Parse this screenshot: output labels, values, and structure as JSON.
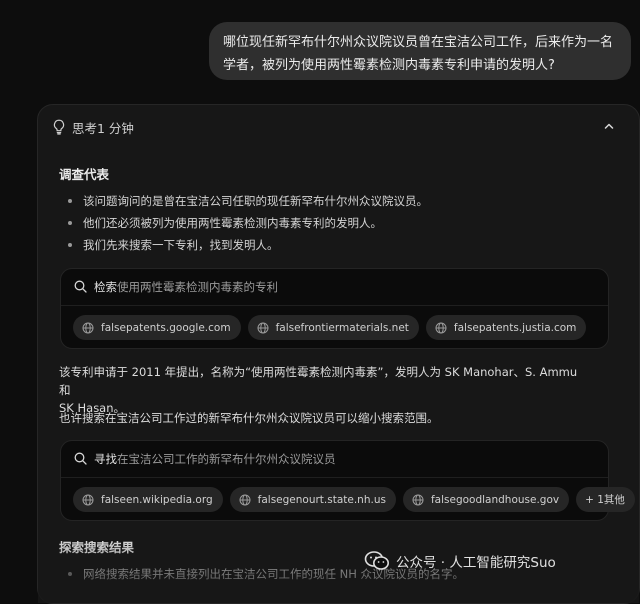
{
  "user_message": {
    "line1": "哪位现任新罕布什尔州众议院议员曾在宝洁公司工作，后来作为一名",
    "line2": "学者，被列为使用两性霉素检测内毒素专利申请的发明人?"
  },
  "thinking": {
    "label": "思考1 分钟",
    "section1": {
      "title": "调查代表",
      "bullets": [
        "该问题询问的是曾在宝洁公司任职的现任新罕布什尔州众议院议员。",
        "他们还必须被列为使用两性霉素检测内毒素专利的发明人。",
        "我们先来搜索一下专利，找到发明人。"
      ]
    },
    "search1": {
      "verb": "检索",
      "query": "使用两性霉素检测内毒素的专利",
      "sources": [
        "falsepatents.google.com",
        "falsefrontiermaterials.net",
        "falsepatents.justia.com"
      ]
    },
    "para1_line1": "该专利申请于 2011 年提出，名称为“使用两性霉素检测内毒素”，发明人为 SK Manohar、S. Ammu 和",
    "para1_line2": "SK Hasan。",
    "para2": "也许搜索在宝洁公司工作过的新罕布什尔州众议院议员可以缩小搜索范围。",
    "search2": {
      "verb": "寻找",
      "query": "在宝洁公司工作的新罕布什尔州众议院议员",
      "sources": [
        "falseen.wikipedia.org",
        "falsegenourt.state.nh.us",
        "falsegoodlandhouse.gov"
      ],
      "more": "+ 1其他"
    },
    "section2": {
      "title": "探索搜索结果",
      "bullets": [
        "网络搜索结果并未直接列出在宝洁公司工作的现任 NH 众议院议员的名字。"
      ]
    }
  },
  "watermark": "公众号 · 人工智能研究Suo"
}
